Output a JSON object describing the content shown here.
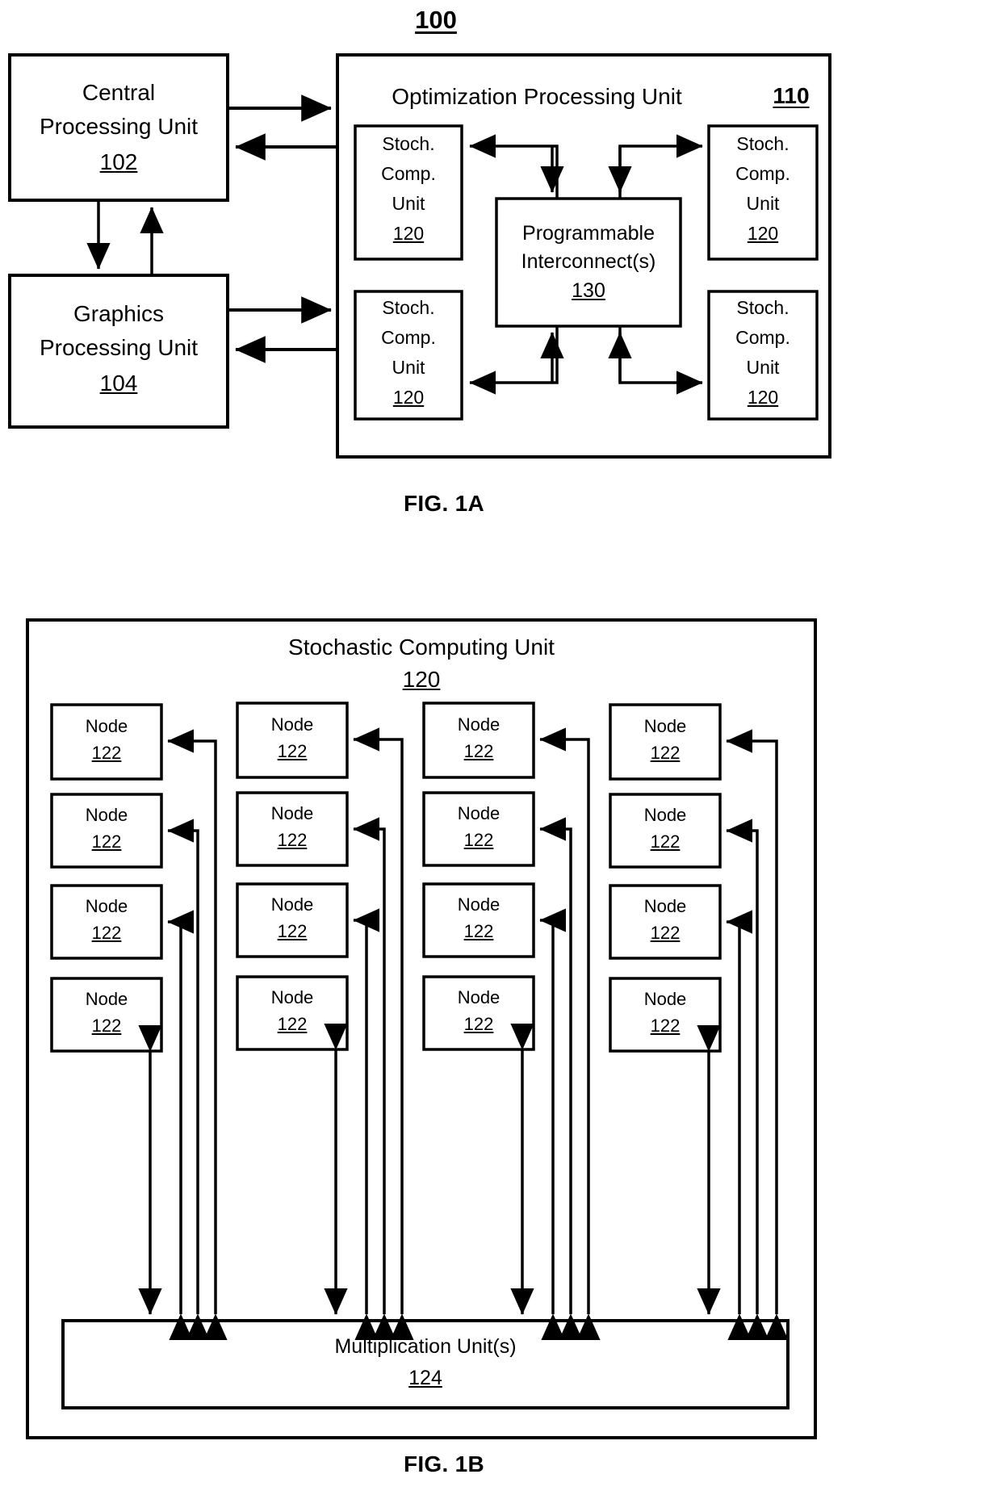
{
  "figures": [
    {
      "id": "fig-1a",
      "caption": "FIG. 1A",
      "system_ref": "100",
      "blocks": {
        "cpu": {
          "title_line1": "Central",
          "title_line2": "Processing Unit",
          "ref": "102"
        },
        "gpu": {
          "title_line1": "Graphics",
          "title_line2": "Processing Unit",
          "ref": "104"
        },
        "opu": {
          "title": "Optimization Processing Unit",
          "ref": "110"
        },
        "interconnect": {
          "title_line1": "Programmable",
          "title_line2": "Interconnect(s)",
          "ref": "130"
        },
        "stoch_units": [
          {
            "line1": "Stoch.",
            "line2": "Comp.",
            "line3": "Unit",
            "ref": "120"
          },
          {
            "line1": "Stoch.",
            "line2": "Comp.",
            "line3": "Unit",
            "ref": "120"
          },
          {
            "line1": "Stoch.",
            "line2": "Comp.",
            "line3": "Unit",
            "ref": "120"
          },
          {
            "line1": "Stoch.",
            "line2": "Comp.",
            "line3": "Unit",
            "ref": "120"
          }
        ]
      }
    },
    {
      "id": "fig-1b",
      "caption": "FIG. 1B",
      "blocks": {
        "scu": {
          "title": "Stochastic Computing Unit",
          "ref": "120"
        },
        "multiplication": {
          "title": "Multiplication Unit(s)",
          "ref": "124"
        },
        "node": {
          "label": "Node",
          "ref": "122"
        },
        "node_grid": {
          "columns": 4,
          "rows": 4,
          "cells": [
            {
              "label": "Node",
              "ref": "122"
            },
            {
              "label": "Node",
              "ref": "122"
            },
            {
              "label": "Node",
              "ref": "122"
            },
            {
              "label": "Node",
              "ref": "122"
            },
            {
              "label": "Node",
              "ref": "122"
            },
            {
              "label": "Node",
              "ref": "122"
            },
            {
              "label": "Node",
              "ref": "122"
            },
            {
              "label": "Node",
              "ref": "122"
            },
            {
              "label": "Node",
              "ref": "122"
            },
            {
              "label": "Node",
              "ref": "122"
            },
            {
              "label": "Node",
              "ref": "122"
            },
            {
              "label": "Node",
              "ref": "122"
            },
            {
              "label": "Node",
              "ref": "122"
            },
            {
              "label": "Node",
              "ref": "122"
            },
            {
              "label": "Node",
              "ref": "122"
            },
            {
              "label": "Node",
              "ref": "122"
            }
          ]
        }
      }
    }
  ],
  "colors": {
    "ink": "#000000",
    "paper": "#ffffff"
  }
}
